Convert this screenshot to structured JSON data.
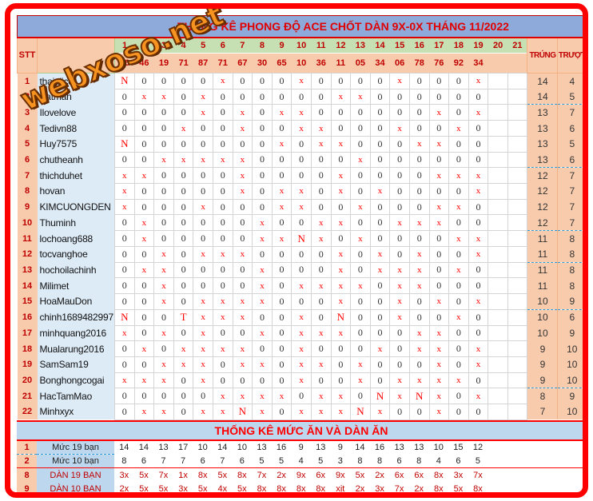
{
  "title": "THỐNG KÊ PHONG ĐỘ ACE CHỐT DÀN 9X-0X THÁNG 11/2022",
  "watermark": "webxoso.net",
  "header": {
    "stt_label": "STT",
    "days": [
      "1",
      "2",
      "3",
      "4",
      "5",
      "6",
      "7",
      "8",
      "9",
      "10",
      "11",
      "12",
      "13",
      "14",
      "15",
      "16",
      "17",
      "18",
      "19",
      "20",
      "21"
    ],
    "results": [
      "76",
      "46",
      "19",
      "71",
      "87",
      "71",
      "67",
      "30",
      "65",
      "10",
      "36",
      "11",
      "05",
      "34",
      "06",
      "78",
      "76",
      "92",
      "34",
      "",
      ""
    ],
    "trung_label": "TRÚNG",
    "truot_label": "TRƯỢT"
  },
  "rows": [
    {
      "stt": "1",
      "name": "thaialice",
      "cells": [
        "N",
        "0",
        "0",
        "0",
        "0",
        "x",
        "0",
        "0",
        "0",
        "x",
        "0",
        "0",
        "0",
        "0",
        "x",
        "0",
        "0",
        "0",
        "x",
        "",
        ""
      ],
      "trung": "14",
      "truot": "4"
    },
    {
      "stt": "2",
      "name": "Batman",
      "cells": [
        "0",
        "x",
        "x",
        "0",
        "x",
        "0",
        "0",
        "0",
        "0",
        "0",
        "0",
        "x",
        "x",
        "0",
        "0",
        "0",
        "0",
        "0",
        "0",
        "",
        ""
      ],
      "trung": "14",
      "truot": "5"
    },
    {
      "stt": "3",
      "name": "Ilovelove",
      "cells": [
        "0",
        "0",
        "0",
        "0",
        "x",
        "0",
        "x",
        "0",
        "x",
        "x",
        "0",
        "0",
        "0",
        "0",
        "0",
        "0",
        "x",
        "0",
        "x",
        "",
        ""
      ],
      "trung": "13",
      "truot": "7"
    },
    {
      "stt": "4",
      "name": "Tedivn88",
      "cells": [
        "0",
        "0",
        "0",
        "x",
        "0",
        "0",
        "x",
        "0",
        "0",
        "x",
        "x",
        "0",
        "0",
        "0",
        "x",
        "0",
        "0",
        "x",
        "0",
        "",
        ""
      ],
      "trung": "13",
      "truot": "6"
    },
    {
      "stt": "5",
      "name": "Huy7575",
      "cells": [
        "N",
        "0",
        "0",
        "0",
        "0",
        "0",
        "0",
        "0",
        "x",
        "0",
        "x",
        "x",
        "0",
        "0",
        "0",
        "x",
        "x",
        "0",
        "0",
        "",
        ""
      ],
      "trung": "13",
      "truot": "5"
    },
    {
      "stt": "6",
      "name": "chutheanh",
      "cells": [
        "0",
        "0",
        "x",
        "x",
        "x",
        "x",
        "x",
        "0",
        "0",
        "0",
        "0",
        "0",
        "x",
        "0",
        "0",
        "0",
        "0",
        "0",
        "0",
        "",
        ""
      ],
      "trung": "13",
      "truot": "6"
    },
    {
      "stt": "7",
      "name": "thichduhet",
      "cells": [
        "x",
        "x",
        "0",
        "0",
        "0",
        "0",
        "x",
        "0",
        "0",
        "0",
        "0",
        "x",
        "0",
        "0",
        "0",
        "0",
        "x",
        "x",
        "x",
        "",
        ""
      ],
      "trung": "12",
      "truot": "7"
    },
    {
      "stt": "8",
      "name": "hovan",
      "cells": [
        "x",
        "0",
        "0",
        "0",
        "0",
        "0",
        "x",
        "0",
        "x",
        "x",
        "0",
        "x",
        "0",
        "x",
        "0",
        "0",
        "0",
        "0",
        "x",
        "",
        ""
      ],
      "trung": "12",
      "truot": "7"
    },
    {
      "stt": "9",
      "name": "KIMCUONGDEN",
      "cells": [
        "x",
        "0",
        "0",
        "0",
        "x",
        "0",
        "0",
        "0",
        "x",
        "x",
        "0",
        "0",
        "x",
        "0",
        "0",
        "0",
        "x",
        "x",
        "0",
        "",
        ""
      ],
      "trung": "12",
      "truot": "7"
    },
    {
      "stt": "10",
      "name": "Thuminh",
      "cells": [
        "0",
        "x",
        "0",
        "0",
        "0",
        "0",
        "0",
        "x",
        "0",
        "0",
        "x",
        "x",
        "0",
        "0",
        "x",
        "x",
        "x",
        "0",
        "0",
        "",
        ""
      ],
      "trung": "12",
      "truot": "7"
    },
    {
      "stt": "11",
      "name": "lochoang688",
      "cells": [
        "0",
        "x",
        "0",
        "0",
        "0",
        "0",
        "0",
        "x",
        "x",
        "N",
        "x",
        "0",
        "x",
        "0",
        "0",
        "0",
        "0",
        "x",
        "x",
        "",
        ""
      ],
      "trung": "11",
      "truot": "8"
    },
    {
      "stt": "12",
      "name": "tocvanghoe",
      "cells": [
        "0",
        "0",
        "x",
        "0",
        "x",
        "x",
        "x",
        "0",
        "0",
        "0",
        "0",
        "x",
        "0",
        "x",
        "0",
        "x",
        "0",
        "0",
        "x",
        "",
        ""
      ],
      "trung": "11",
      "truot": "8"
    },
    {
      "stt": "13",
      "name": "hochoilachinh",
      "cells": [
        "0",
        "x",
        "x",
        "0",
        "0",
        "0",
        "0",
        "x",
        "0",
        "0",
        "0",
        "x",
        "0",
        "x",
        "x",
        "x",
        "0",
        "x",
        "0",
        "",
        ""
      ],
      "trung": "11",
      "truot": "8"
    },
    {
      "stt": "14",
      "name": "Milimet",
      "cells": [
        "0",
        "0",
        "x",
        "0",
        "0",
        "0",
        "0",
        "x",
        "0",
        "x",
        "x",
        "x",
        "x",
        "0",
        "x",
        "x",
        "0",
        "0",
        "0",
        "",
        ""
      ],
      "trung": "11",
      "truot": "8"
    },
    {
      "stt": "15",
      "name": "HoaMauDon",
      "cells": [
        "0",
        "0",
        "x",
        "0",
        "x",
        "x",
        "x",
        "x",
        "0",
        "0",
        "0",
        "x",
        "0",
        "0",
        "x",
        "0",
        "x",
        "0",
        "x",
        "",
        ""
      ],
      "trung": "10",
      "truot": "9"
    },
    {
      "stt": "16",
      "name": "chinh1689482997",
      "cells": [
        "N",
        "0",
        "0",
        "T",
        "x",
        "x",
        "x",
        "0",
        "0",
        "x",
        "0",
        "N",
        "0",
        "0",
        "x",
        "0",
        "0",
        "x",
        "0",
        "",
        ""
      ],
      "trung": "10",
      "truot": "6"
    },
    {
      "stt": "17",
      "name": "minhquang2016",
      "cells": [
        "x",
        "0",
        "x",
        "0",
        "x",
        "0",
        "0",
        "x",
        "0",
        "x",
        "x",
        "x",
        "0",
        "0",
        "0",
        "x",
        "x",
        "0",
        "0",
        "",
        ""
      ],
      "trung": "10",
      "truot": "9"
    },
    {
      "stt": "18",
      "name": "Mualarung2016",
      "cells": [
        "0",
        "x",
        "0",
        "x",
        "x",
        "x",
        "x",
        "0",
        "0",
        "x",
        "0",
        "0",
        "0",
        "x",
        "0",
        "x",
        "x",
        "0",
        "x",
        "",
        ""
      ],
      "trung": "9",
      "truot": "10"
    },
    {
      "stt": "19",
      "name": "SamSam19",
      "cells": [
        "0",
        "0",
        "x",
        "x",
        "x",
        "0",
        "x",
        "x",
        "0",
        "x",
        "x",
        "0",
        "x",
        "0",
        "0",
        "0",
        "x",
        "0",
        "x",
        "",
        ""
      ],
      "trung": "9",
      "truot": "10"
    },
    {
      "stt": "20",
      "name": "Bonghongcogai",
      "cells": [
        "x",
        "x",
        "x",
        "0",
        "x",
        "0",
        "0",
        "0",
        "0",
        "x",
        "0",
        "0",
        "x",
        "0",
        "x",
        "x",
        "x",
        "x",
        "0",
        "",
        ""
      ],
      "trung": "9",
      "truot": "10"
    },
    {
      "stt": "21",
      "name": "HacTamMao",
      "cells": [
        "0",
        "0",
        "0",
        "0",
        "0",
        "x",
        "x",
        "x",
        "x",
        "0",
        "x",
        "x",
        "0",
        "N",
        "x",
        "N",
        "x",
        "0",
        "x",
        "",
        ""
      ],
      "trung": "8",
      "truot": "9"
    },
    {
      "stt": "22",
      "name": "Minhxyx",
      "cells": [
        "0",
        "x",
        "x",
        "0",
        "x",
        "x",
        "N",
        "x",
        "0",
        "x",
        "x",
        "x",
        "N",
        "x",
        "0",
        "0",
        "x",
        "0",
        "0",
        "",
        ""
      ],
      "trung": "7",
      "truot": "10"
    }
  ],
  "score_dashed_before": [
    3,
    7,
    11,
    13,
    16,
    21
  ],
  "summary": {
    "title": "THỐNG KÊ MỨC ĂN VÀ DÀN ĂN",
    "rows": [
      {
        "stt": "1",
        "label": "Mức 19 bạn",
        "values": [
          "14",
          "14",
          "13",
          "17",
          "10",
          "14",
          "10",
          "13",
          "16",
          "9",
          "13",
          "9",
          "14",
          "16",
          "13",
          "13",
          "10",
          "15",
          "12"
        ],
        "red": false
      },
      {
        "stt": "2",
        "label": "Mức 10 bạn",
        "values": [
          "8",
          "6",
          "7",
          "7",
          "6",
          "7",
          "6",
          "5",
          "5",
          "4",
          "5",
          "3",
          "8",
          "8",
          "6",
          "8",
          "4",
          "6",
          "5"
        ],
        "red": false
      },
      {
        "stt": "8",
        "label": "DÀN 19 BẠN",
        "values": [
          "3x",
          "5x",
          "7x",
          "1x",
          "8x",
          "5x",
          "8x",
          "7x",
          "2x",
          "9x",
          "6x",
          "9x",
          "5x",
          "2x",
          "6x",
          "6x",
          "8x",
          "3x",
          "7x"
        ],
        "red": true
      },
      {
        "stt": "9",
        "label": "DÀN 10 BẠN",
        "values": [
          "2x",
          "5x",
          "5x",
          "3x",
          "5x",
          "4x",
          "5x",
          "8x",
          "8x",
          "8x",
          "8x",
          "xịt",
          "2x",
          "3x",
          "7x",
          "2x",
          "8x",
          "5x",
          "8x"
        ],
        "red": true
      }
    ]
  }
}
